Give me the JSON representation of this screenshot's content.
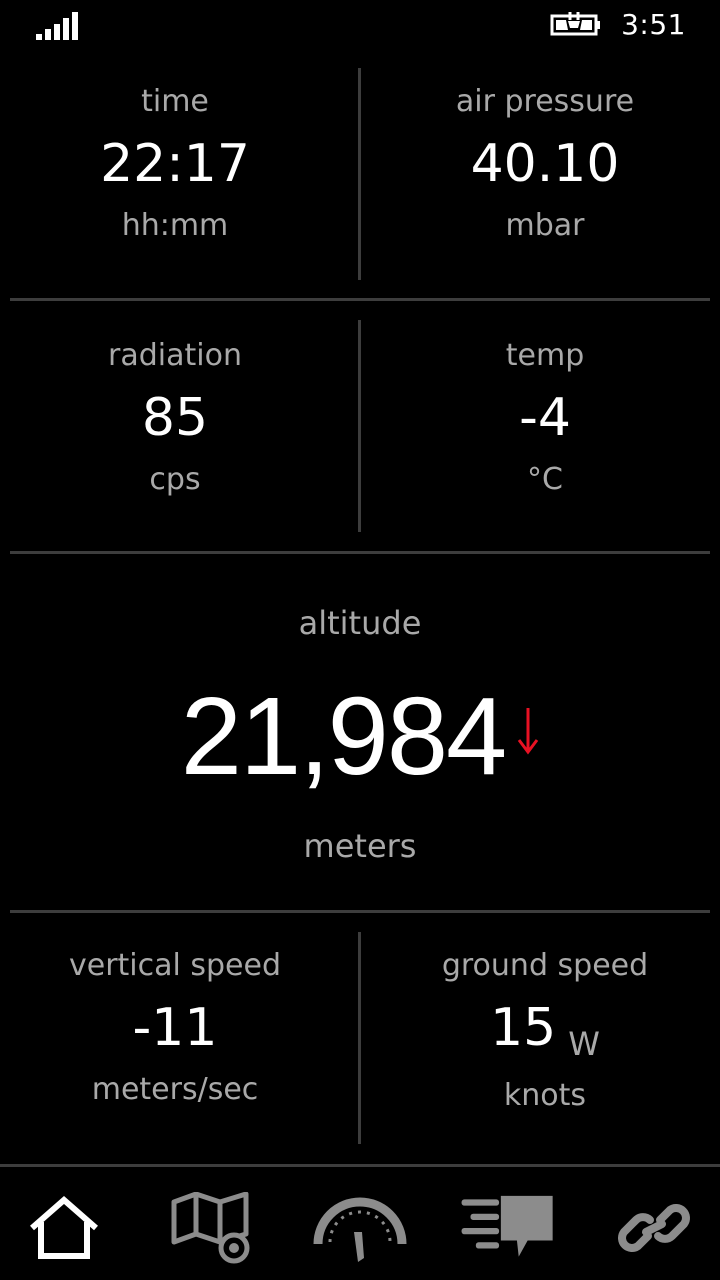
{
  "status_bar": {
    "time": "3:51",
    "icons": [
      "signal-strength-icon",
      "battery-charging-icon"
    ]
  },
  "tiles": {
    "time": {
      "label": "time",
      "value": "22:17",
      "unit": "hh:mm"
    },
    "air_pressure": {
      "label": "air pressure",
      "value": "40.10",
      "unit": "mbar"
    },
    "radiation": {
      "label": "radiation",
      "value": "85",
      "unit": "cps"
    },
    "temp": {
      "label": "temp",
      "value": "-4",
      "unit": "°C"
    },
    "vertical_speed": {
      "label": "vertical speed",
      "value": "-11",
      "unit": "meters/sec"
    },
    "ground_speed": {
      "label": "ground speed",
      "value": "15",
      "direction": "W",
      "unit": "knots"
    }
  },
  "altitude": {
    "label": "altitude",
    "value": "21,984",
    "unit": "meters",
    "trend": "down",
    "trend_color": "#e81123"
  },
  "nav": {
    "items": [
      {
        "icon": "home-icon",
        "active": true
      },
      {
        "icon": "map-icon",
        "active": false
      },
      {
        "icon": "speedometer-icon",
        "active": false
      },
      {
        "icon": "messages-icon",
        "active": false
      },
      {
        "icon": "link-icon",
        "active": false
      }
    ]
  },
  "colors": {
    "background": "#000000",
    "label": "#a9a9a9",
    "value": "#ffffff",
    "divider": "#3d3d3d",
    "inactive_icon": "#8c8c8c",
    "active_icon": "#ffffff"
  }
}
